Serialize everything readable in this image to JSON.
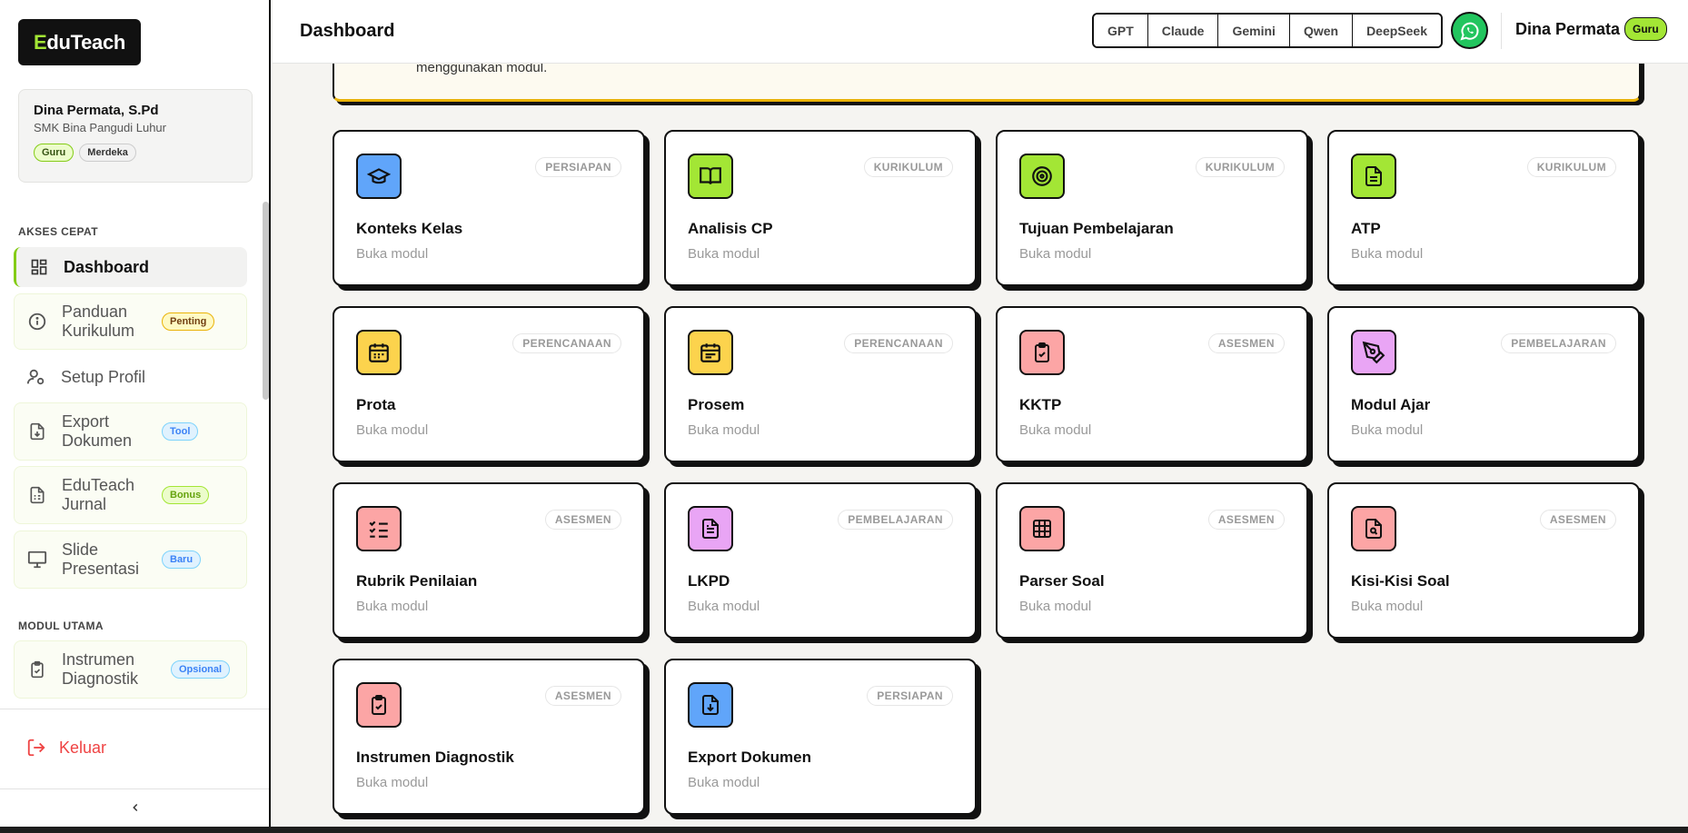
{
  "brand": {
    "logo_first": "E",
    "logo_rest": "duTeach"
  },
  "profile": {
    "name": "Dina Permata, S.Pd",
    "school": "SMK Bina Pangudi Luhur",
    "chips": [
      "Guru",
      "Merdeka"
    ]
  },
  "sidebar": {
    "section_quick": "AKSES CEPAT",
    "section_main": "MODUL UTAMA",
    "items": [
      {
        "label": "Dashboard",
        "badge": ""
      },
      {
        "label": "Panduan Kurikulum",
        "badge": "Penting"
      },
      {
        "label": "Setup Profil",
        "badge": ""
      },
      {
        "label": "Export Dokumen",
        "badge": "Tool"
      },
      {
        "label": "EduTeach Jurnal",
        "badge": "Bonus"
      },
      {
        "label": "Slide Presentasi",
        "badge": "Baru"
      },
      {
        "label": "Instrumen Diagnostik",
        "badge": "Opsional"
      }
    ],
    "logout": "Keluar"
  },
  "header": {
    "title": "Dashboard",
    "ai_models": [
      "GPT",
      "Claude",
      "Gemini",
      "Qwen",
      "DeepSeek"
    ],
    "user_name": "Dina Permata",
    "user_role": "Guru"
  },
  "notice": {
    "text": "menggunakan modul."
  },
  "cards": [
    {
      "title": "Konteks Kelas",
      "tag": "PERSIAPAN",
      "sub": "Buka modul",
      "icon": "graduation-cap-icon",
      "color": "#60a5fa"
    },
    {
      "title": "Analisis CP",
      "tag": "KURIKULUM",
      "sub": "Buka modul",
      "icon": "book-open-icon",
      "color": "#a3e635"
    },
    {
      "title": "Tujuan Pembelajaran",
      "tag": "KURIKULUM",
      "sub": "Buka modul",
      "icon": "target-icon",
      "color": "#a3e635"
    },
    {
      "title": "ATP",
      "tag": "KURIKULUM",
      "sub": "Buka modul",
      "icon": "file-text-icon",
      "color": "#a3e635"
    },
    {
      "title": "Prota",
      "tag": "PERENCANAAN",
      "sub": "Buka modul",
      "icon": "calendar-icon",
      "color": "#fcd34d"
    },
    {
      "title": "Prosem",
      "tag": "PERENCANAAN",
      "sub": "Buka modul",
      "icon": "calendar-range-icon",
      "color": "#fcd34d"
    },
    {
      "title": "KKTP",
      "tag": "ASESMEN",
      "sub": "Buka modul",
      "icon": "clipboard-check-icon",
      "color": "#fca5a5"
    },
    {
      "title": "Modul Ajar",
      "tag": "PEMBELAJARAN",
      "sub": "Buka modul",
      "icon": "pen-tool-icon",
      "color": "#e9a5f5"
    },
    {
      "title": "Rubrik Penilaian",
      "tag": "ASESMEN",
      "sub": "Buka modul",
      "icon": "list-checks-icon",
      "color": "#fca5a5"
    },
    {
      "title": "LKPD",
      "tag": "PEMBELAJARAN",
      "sub": "Buka modul",
      "icon": "file-lines-icon",
      "color": "#e9a5f5"
    },
    {
      "title": "Parser Soal",
      "tag": "ASESMEN",
      "sub": "Buka modul",
      "icon": "grid-icon",
      "color": "#fca5a5"
    },
    {
      "title": "Kisi-Kisi Soal",
      "tag": "ASESMEN",
      "sub": "Buka modul",
      "icon": "file-search-icon",
      "color": "#fca5a5"
    },
    {
      "title": "Instrumen Diagnostik",
      "tag": "ASESMEN",
      "sub": "Buka modul",
      "icon": "clipboard-check-icon",
      "color": "#fca5a5"
    },
    {
      "title": "Export Dokumen",
      "tag": "PERSIAPAN",
      "sub": "Buka modul",
      "icon": "file-download-icon",
      "color": "#60a5fa"
    }
  ]
}
